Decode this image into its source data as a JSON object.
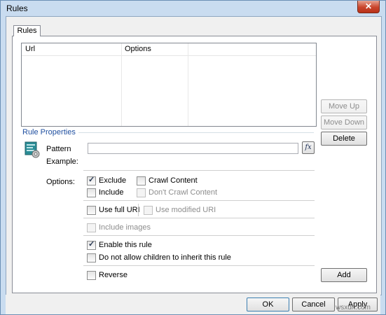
{
  "window": {
    "title": "Rules",
    "close_glyph": "✕"
  },
  "tabs": [
    {
      "label": "Rules"
    }
  ],
  "list": {
    "columns": [
      {
        "label": "Url"
      },
      {
        "label": "Options"
      },
      {
        "label": ""
      }
    ],
    "rows": []
  },
  "side_buttons": {
    "move_up": {
      "label": "Move Up",
      "enabled": false
    },
    "move_down": {
      "label": "Move Down",
      "enabled": false
    },
    "delete": {
      "label": "Delete",
      "enabled": true
    }
  },
  "rule_properties": {
    "group_title": "Rule Properties",
    "pattern_label": "Pattern",
    "pattern_value": "",
    "example_label": "Example:",
    "fx_label": "fx",
    "options_label": "Options:",
    "icon": "rule-settings-icon",
    "accent_color": "#1f4fa0"
  },
  "options": {
    "exclude": {
      "label": "Exclude",
      "checked": true,
      "enabled": true
    },
    "include": {
      "label": "Include",
      "checked": false,
      "enabled": true
    },
    "crawl_content": {
      "label": "Crawl Content",
      "checked": false,
      "enabled": true
    },
    "dont_crawl_content": {
      "label": "Don't Crawl Content",
      "checked": false,
      "enabled": false
    },
    "use_full_uri": {
      "label": "Use full URI",
      "checked": false,
      "enabled": true
    },
    "use_modified_uri": {
      "label": "Use modified URI",
      "checked": false,
      "enabled": false
    },
    "include_images": {
      "label": "Include images",
      "checked": false,
      "enabled": false
    },
    "enable_rule": {
      "label": "Enable this rule",
      "checked": true,
      "enabled": true
    },
    "no_inherit": {
      "label": "Do not allow children to inherit this rule",
      "checked": false,
      "enabled": true
    },
    "reverse": {
      "label": "Reverse",
      "checked": false,
      "enabled": true
    }
  },
  "add_button": {
    "label": "Add"
  },
  "footer": {
    "ok": "OK",
    "cancel": "Cancel",
    "apply": "Apply"
  },
  "watermark": "wsxdn.com"
}
